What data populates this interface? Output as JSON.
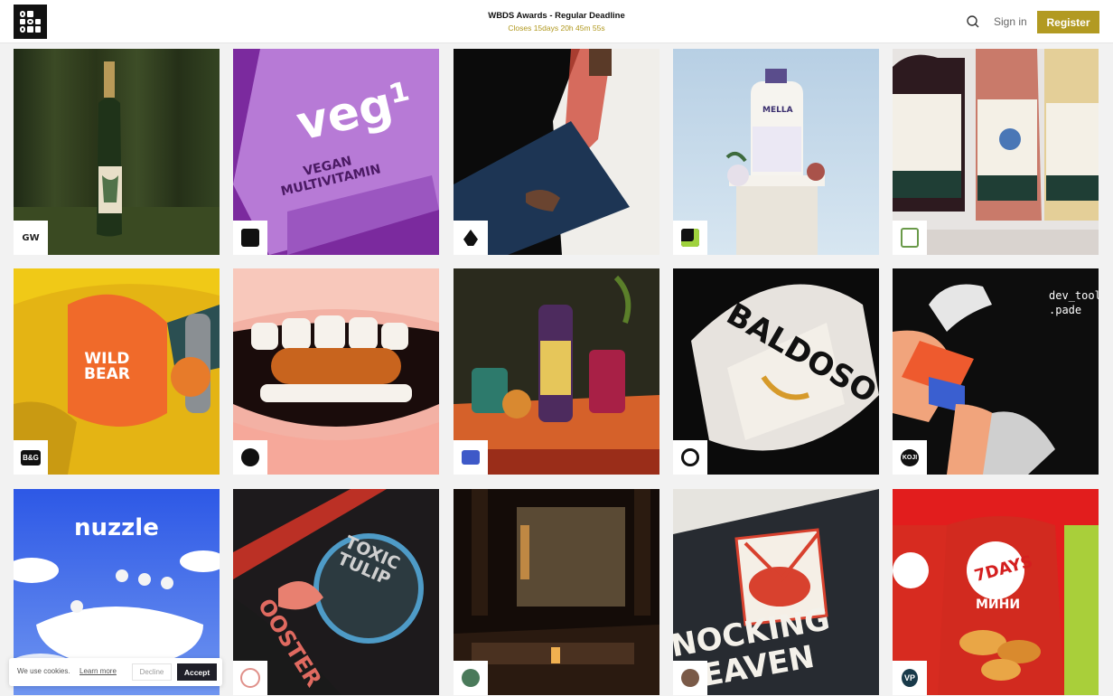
{
  "header": {
    "title": "WBDS Awards - Regular Deadline",
    "countdown": "Closes 15days 20h 45m 55s",
    "signin_label": "Sign in",
    "register_label": "Register"
  },
  "tiles": [
    {
      "name": "sake-bottle-green-curtain",
      "badge_text": "GW"
    },
    {
      "name": "veg1-vegan-multivitamin",
      "overlay_1": "veg¹",
      "overlay_2": "VEGAN\nMULTIVITAMIN",
      "badge_text": ""
    },
    {
      "name": "man-in-thobe-with-folder",
      "badge_text": ""
    },
    {
      "name": "mella-laundry-wash",
      "overlay_1": "MELLA",
      "badge_text": ""
    },
    {
      "name": "wine-bottles-floral-labels",
      "badge_text": ""
    },
    {
      "name": "wild-bear-yellow-bag",
      "overlay_1": "WILD\nBEAR",
      "badge_text": "B&G"
    },
    {
      "name": "capsule-between-teeth",
      "badge_text": ""
    },
    {
      "name": "bottle-and-drinks-table",
      "badge_text": ""
    },
    {
      "name": "mezcal-baldoso-bottle",
      "overlay_1": "BALDOSO",
      "badge_text": ""
    },
    {
      "name": "dev-tool-padel-illustration",
      "overlay_1": "dev_tool\n.pade",
      "badge_text": "KOJI"
    },
    {
      "name": "nuzzle-pillow-sheep",
      "overlay_1": "nuzzle",
      "badge_text": ""
    },
    {
      "name": "toxic-tulip-rooster",
      "overlay_1": "TOXIC\nTULIP",
      "overlay_2": "OOSTER",
      "badge_text": ""
    },
    {
      "name": "asian-restaurant-interior",
      "badge_text": ""
    },
    {
      "name": "nocking-heaven-burger-bag",
      "overlay_1": "NOCKING\nHEAVEN",
      "badge_text": ""
    },
    {
      "name": "7days-croissant-packs",
      "overlay_1": "7DAYS",
      "overlay_2": "МИНИ",
      "badge_text": "VP"
    }
  ],
  "cookie": {
    "message": "We use cookies.",
    "learn_more": "Learn more",
    "decline": "Decline",
    "accept": "Accept"
  },
  "colors": {
    "accent": "#b29a22",
    "countdown": "#b0981e"
  }
}
